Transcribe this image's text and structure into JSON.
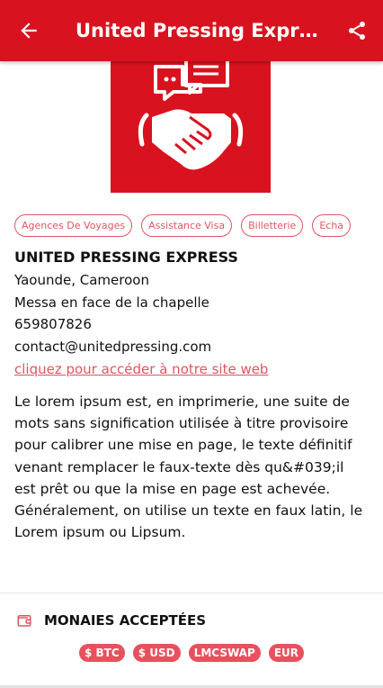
{
  "appbar": {
    "title": "United Pressing Expre...",
    "back_icon": "arrow-left-icon",
    "share_icon": "share-icon"
  },
  "logo": {
    "icon": "handshake-chat-icon",
    "bg_color": "#d9121f"
  },
  "tags": [
    "Agences De Voyages",
    "Assistance Visa",
    "Billetterie",
    "Echa"
  ],
  "company": {
    "name": "UNITED PRESSING EXPRESS",
    "city": "Yaounde, Cameroon",
    "address": "Messa en face de la chapelle",
    "phone": "659807826",
    "email": "contact@unitedpressing.com",
    "website_link": "cliquez pour accéder à notre site web"
  },
  "description": "Le lorem ipsum est, en imprimerie, une suite de mots sans signification utilisée à titre provisoire pour calibrer une mise en page, le texte définitif venant remplacer le faux-texte dès qu&#039;il est prêt ou que la mise en page est achevée. Généralement, on utilise un texte en faux latin, le Lorem ipsum ou Lipsum.",
  "currencies": {
    "title": "MONAIES ACCEPTÉES",
    "icon": "wallet-icon",
    "items": [
      "$ BTC",
      "$ USD",
      "LMCSWAP",
      "EUR"
    ]
  },
  "colors": {
    "primary": "#d9121f",
    "accent": "#e05560"
  }
}
